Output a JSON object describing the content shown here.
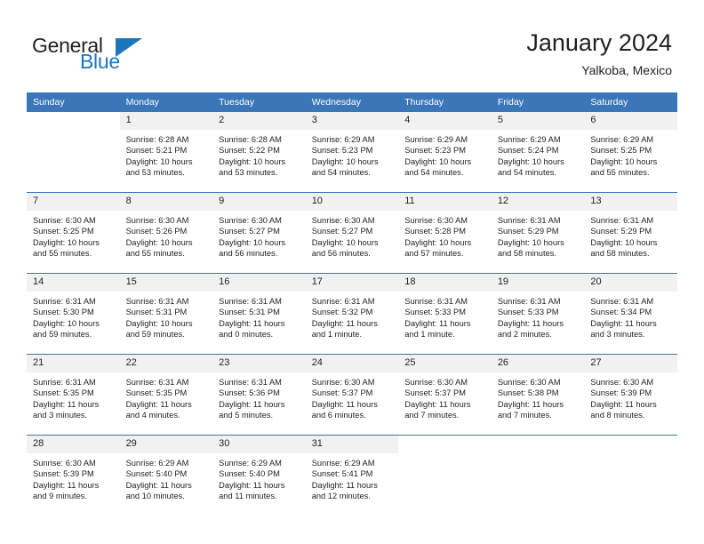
{
  "brand": {
    "name_part1": "General",
    "name_part2": "Blue",
    "triangle_icon": "triangle-icon",
    "accent_color": "#1b75bb"
  },
  "header": {
    "title": "January 2024",
    "location": "Yalkoba, Mexico"
  },
  "theme": {
    "header_bg": "#3a76b8",
    "daynum_bg": "#f1f1f1",
    "grid_line": "#3a76b8",
    "text": "#231f20"
  },
  "weekdays": [
    "Sunday",
    "Monday",
    "Tuesday",
    "Wednesday",
    "Thursday",
    "Friday",
    "Saturday"
  ],
  "weeks": [
    [
      {
        "day": "",
        "lines": []
      },
      {
        "day": "1",
        "lines": [
          "Sunrise: 6:28 AM",
          "Sunset: 5:21 PM",
          "Daylight: 10 hours",
          "and 53 minutes."
        ]
      },
      {
        "day": "2",
        "lines": [
          "Sunrise: 6:28 AM",
          "Sunset: 5:22 PM",
          "Daylight: 10 hours",
          "and 53 minutes."
        ]
      },
      {
        "day": "3",
        "lines": [
          "Sunrise: 6:29 AM",
          "Sunset: 5:23 PM",
          "Daylight: 10 hours",
          "and 54 minutes."
        ]
      },
      {
        "day": "4",
        "lines": [
          "Sunrise: 6:29 AM",
          "Sunset: 5:23 PM",
          "Daylight: 10 hours",
          "and 54 minutes."
        ]
      },
      {
        "day": "5",
        "lines": [
          "Sunrise: 6:29 AM",
          "Sunset: 5:24 PM",
          "Daylight: 10 hours",
          "and 54 minutes."
        ]
      },
      {
        "day": "6",
        "lines": [
          "Sunrise: 6:29 AM",
          "Sunset: 5:25 PM",
          "Daylight: 10 hours",
          "and 55 minutes."
        ]
      }
    ],
    [
      {
        "day": "7",
        "lines": [
          "Sunrise: 6:30 AM",
          "Sunset: 5:25 PM",
          "Daylight: 10 hours",
          "and 55 minutes."
        ]
      },
      {
        "day": "8",
        "lines": [
          "Sunrise: 6:30 AM",
          "Sunset: 5:26 PM",
          "Daylight: 10 hours",
          "and 55 minutes."
        ]
      },
      {
        "day": "9",
        "lines": [
          "Sunrise: 6:30 AM",
          "Sunset: 5:27 PM",
          "Daylight: 10 hours",
          "and 56 minutes."
        ]
      },
      {
        "day": "10",
        "lines": [
          "Sunrise: 6:30 AM",
          "Sunset: 5:27 PM",
          "Daylight: 10 hours",
          "and 56 minutes."
        ]
      },
      {
        "day": "11",
        "lines": [
          "Sunrise: 6:30 AM",
          "Sunset: 5:28 PM",
          "Daylight: 10 hours",
          "and 57 minutes."
        ]
      },
      {
        "day": "12",
        "lines": [
          "Sunrise: 6:31 AM",
          "Sunset: 5:29 PM",
          "Daylight: 10 hours",
          "and 58 minutes."
        ]
      },
      {
        "day": "13",
        "lines": [
          "Sunrise: 6:31 AM",
          "Sunset: 5:29 PM",
          "Daylight: 10 hours",
          "and 58 minutes."
        ]
      }
    ],
    [
      {
        "day": "14",
        "lines": [
          "Sunrise: 6:31 AM",
          "Sunset: 5:30 PM",
          "Daylight: 10 hours",
          "and 59 minutes."
        ]
      },
      {
        "day": "15",
        "lines": [
          "Sunrise: 6:31 AM",
          "Sunset: 5:31 PM",
          "Daylight: 10 hours",
          "and 59 minutes."
        ]
      },
      {
        "day": "16",
        "lines": [
          "Sunrise: 6:31 AM",
          "Sunset: 5:31 PM",
          "Daylight: 11 hours",
          "and 0 minutes."
        ]
      },
      {
        "day": "17",
        "lines": [
          "Sunrise: 6:31 AM",
          "Sunset: 5:32 PM",
          "Daylight: 11 hours",
          "and 1 minute."
        ]
      },
      {
        "day": "18",
        "lines": [
          "Sunrise: 6:31 AM",
          "Sunset: 5:33 PM",
          "Daylight: 11 hours",
          "and 1 minute."
        ]
      },
      {
        "day": "19",
        "lines": [
          "Sunrise: 6:31 AM",
          "Sunset: 5:33 PM",
          "Daylight: 11 hours",
          "and 2 minutes."
        ]
      },
      {
        "day": "20",
        "lines": [
          "Sunrise: 6:31 AM",
          "Sunset: 5:34 PM",
          "Daylight: 11 hours",
          "and 3 minutes."
        ]
      }
    ],
    [
      {
        "day": "21",
        "lines": [
          "Sunrise: 6:31 AM",
          "Sunset: 5:35 PM",
          "Daylight: 11 hours",
          "and 3 minutes."
        ]
      },
      {
        "day": "22",
        "lines": [
          "Sunrise: 6:31 AM",
          "Sunset: 5:35 PM",
          "Daylight: 11 hours",
          "and 4 minutes."
        ]
      },
      {
        "day": "23",
        "lines": [
          "Sunrise: 6:31 AM",
          "Sunset: 5:36 PM",
          "Daylight: 11 hours",
          "and 5 minutes."
        ]
      },
      {
        "day": "24",
        "lines": [
          "Sunrise: 6:30 AM",
          "Sunset: 5:37 PM",
          "Daylight: 11 hours",
          "and 6 minutes."
        ]
      },
      {
        "day": "25",
        "lines": [
          "Sunrise: 6:30 AM",
          "Sunset: 5:37 PM",
          "Daylight: 11 hours",
          "and 7 minutes."
        ]
      },
      {
        "day": "26",
        "lines": [
          "Sunrise: 6:30 AM",
          "Sunset: 5:38 PM",
          "Daylight: 11 hours",
          "and 7 minutes."
        ]
      },
      {
        "day": "27",
        "lines": [
          "Sunrise: 6:30 AM",
          "Sunset: 5:39 PM",
          "Daylight: 11 hours",
          "and 8 minutes."
        ]
      }
    ],
    [
      {
        "day": "28",
        "lines": [
          "Sunrise: 6:30 AM",
          "Sunset: 5:39 PM",
          "Daylight: 11 hours",
          "and 9 minutes."
        ]
      },
      {
        "day": "29",
        "lines": [
          "Sunrise: 6:29 AM",
          "Sunset: 5:40 PM",
          "Daylight: 11 hours",
          "and 10 minutes."
        ]
      },
      {
        "day": "30",
        "lines": [
          "Sunrise: 6:29 AM",
          "Sunset: 5:40 PM",
          "Daylight: 11 hours",
          "and 11 minutes."
        ]
      },
      {
        "day": "31",
        "lines": [
          "Sunrise: 6:29 AM",
          "Sunset: 5:41 PM",
          "Daylight: 11 hours",
          "and 12 minutes."
        ]
      },
      {
        "day": "",
        "lines": []
      },
      {
        "day": "",
        "lines": []
      },
      {
        "day": "",
        "lines": []
      }
    ]
  ]
}
